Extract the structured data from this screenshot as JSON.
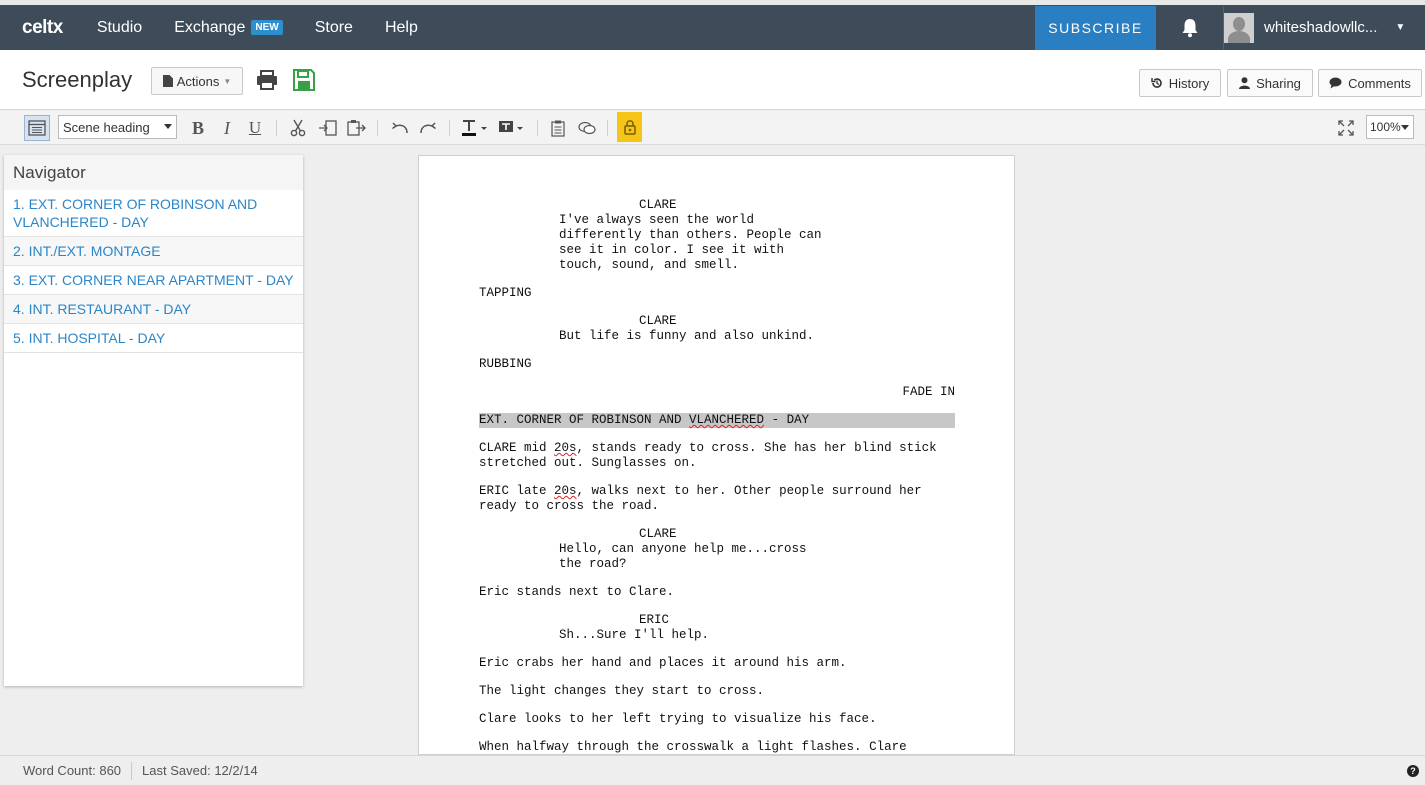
{
  "topnav": {
    "logo": "celtx",
    "items": [
      {
        "label": "Studio"
      },
      {
        "label": "Exchange",
        "badge": "NEW"
      },
      {
        "label": "Store"
      },
      {
        "label": "Help"
      }
    ],
    "subscribe": "SUBSCRIBE",
    "username": "whiteshadowllc..."
  },
  "titlebar": {
    "title": "Screenplay",
    "actions": "Actions",
    "history": "History",
    "sharing": "Sharing",
    "comments": "Comments"
  },
  "toolbar": {
    "element_type": "Scene heading",
    "zoom": "100%",
    "bold": "B",
    "italic": "I",
    "underline": "U"
  },
  "navigator": {
    "title": "Navigator",
    "scenes": [
      "1. EXT. CORNER OF ROBINSON AND VLANCHERED - DAY",
      "2. INT./EXT. MONTAGE",
      "3. EXT. CORNER NEAR APARTMENT - DAY",
      "4. INT. RESTAURANT - DAY",
      "5. INT. HOSPITAL - DAY"
    ]
  },
  "script": {
    "c1": "CLARE",
    "d1": "I've always seen the world differently than others. People can see it in color. I see it with touch, sound, and smell.",
    "a1": "TAPPING",
    "c2": "CLARE",
    "d2": "But life is funny and also unkind.",
    "a2": "RUBBING",
    "t1": "FADE IN",
    "h1a": "EXT. CORNER OF ROBINSON AND ",
    "h1b": "VLANCHERED",
    "h1c": " - DAY",
    "a3a": "CLARE mid ",
    "a3b": "20s",
    "a3c": ", stands ready to cross. She has her blind stick stretched out. Sunglasses on.",
    "a4a": "ERIC late ",
    "a4b": "20s",
    "a4c": ", walks next to her. Other people surround her ready to cross the road.",
    "c3": "CLARE",
    "d3": "Hello, can anyone help me...cross the road?",
    "a5": "Eric stands next to Clare.",
    "c4": "ERIC",
    "d4": "Sh...Sure I'll help.",
    "a6": "Eric crabs her hand and places it around his arm.",
    "a7": "The light changes they start to cross.",
    "a8": "Clare looks to her left trying to visualize his face.",
    "a9": "When halfway through the crosswalk a light flashes. Clare"
  },
  "status": {
    "word_count": "Word Count: 860",
    "last_saved": "Last Saved: 12/2/14",
    "help": "?"
  }
}
